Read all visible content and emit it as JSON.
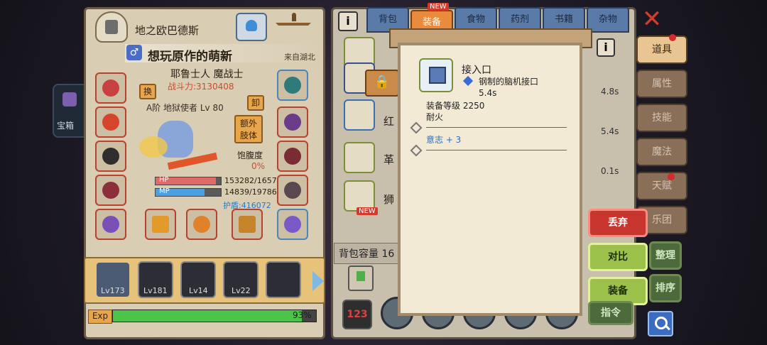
{
  "left_panel": {
    "location": "地之欧巴德斯",
    "player_name": "想玩原作的萌新",
    "origin": "来自湖北",
    "class_name": "耶鲁士人 魔战士",
    "power": "战斗力:3130408",
    "rank": "A阶 地狱使者 Lv 80",
    "swap_label": "换",
    "unload_label": "卸",
    "extra_limbs_label": "额外肢体",
    "satiety_label": "饱腹度",
    "satiety_value": "0%",
    "hp_label": "HP",
    "hp_value": "153282/1657",
    "hp_fill": 0.92,
    "mp_label": "MP",
    "mp_value": "14839/19786",
    "mp_fill": 0.75,
    "shield": "护盾:416072",
    "exp_label": "Exp",
    "exp_value": "93%",
    "exp_fill": 0.93,
    "party": [
      {
        "level": "Lv173"
      },
      {
        "level": "Lv181"
      },
      {
        "level": "Lv14"
      },
      {
        "level": "Lv22"
      },
      {
        "level": ""
      }
    ]
  },
  "side_tab": {
    "label": "宝箱"
  },
  "bag": {
    "tabs": [
      {
        "label": "背包"
      },
      {
        "label": "装备",
        "badge": "NEW"
      },
      {
        "label": "食物"
      },
      {
        "label": "药剂"
      },
      {
        "label": "书籍"
      },
      {
        "label": "杂物"
      }
    ],
    "items": [
      {
        "name": "红",
        "timer": "4.8s"
      },
      {
        "name": "革",
        "timer": "5.4s"
      },
      {
        "name": "狮",
        "timer": "0.1s",
        "badge": "NEW"
      }
    ],
    "capacity": "背包容量 16"
  },
  "popup": {
    "item_name": "接入口",
    "subtype": "钢制的脑机接口",
    "time": "5.4s",
    "level": "装备等级 2250",
    "property": "耐火",
    "bonus": "意志 + 3"
  },
  "side_menu": [
    {
      "label": "道具"
    },
    {
      "label": "属性"
    },
    {
      "label": "技能"
    },
    {
      "label": "魔法"
    },
    {
      "label": "天赋"
    },
    {
      "label": "乐团"
    }
  ],
  "actions": {
    "discard": "丢弃",
    "compare": "对比",
    "equip": "装备",
    "organize": "整理",
    "sort": "排序",
    "command": "指令"
  },
  "colors": {
    "accent_red": "#c7352e",
    "accent_green": "#9bc14a",
    "tab_active": "#e98a3c"
  }
}
